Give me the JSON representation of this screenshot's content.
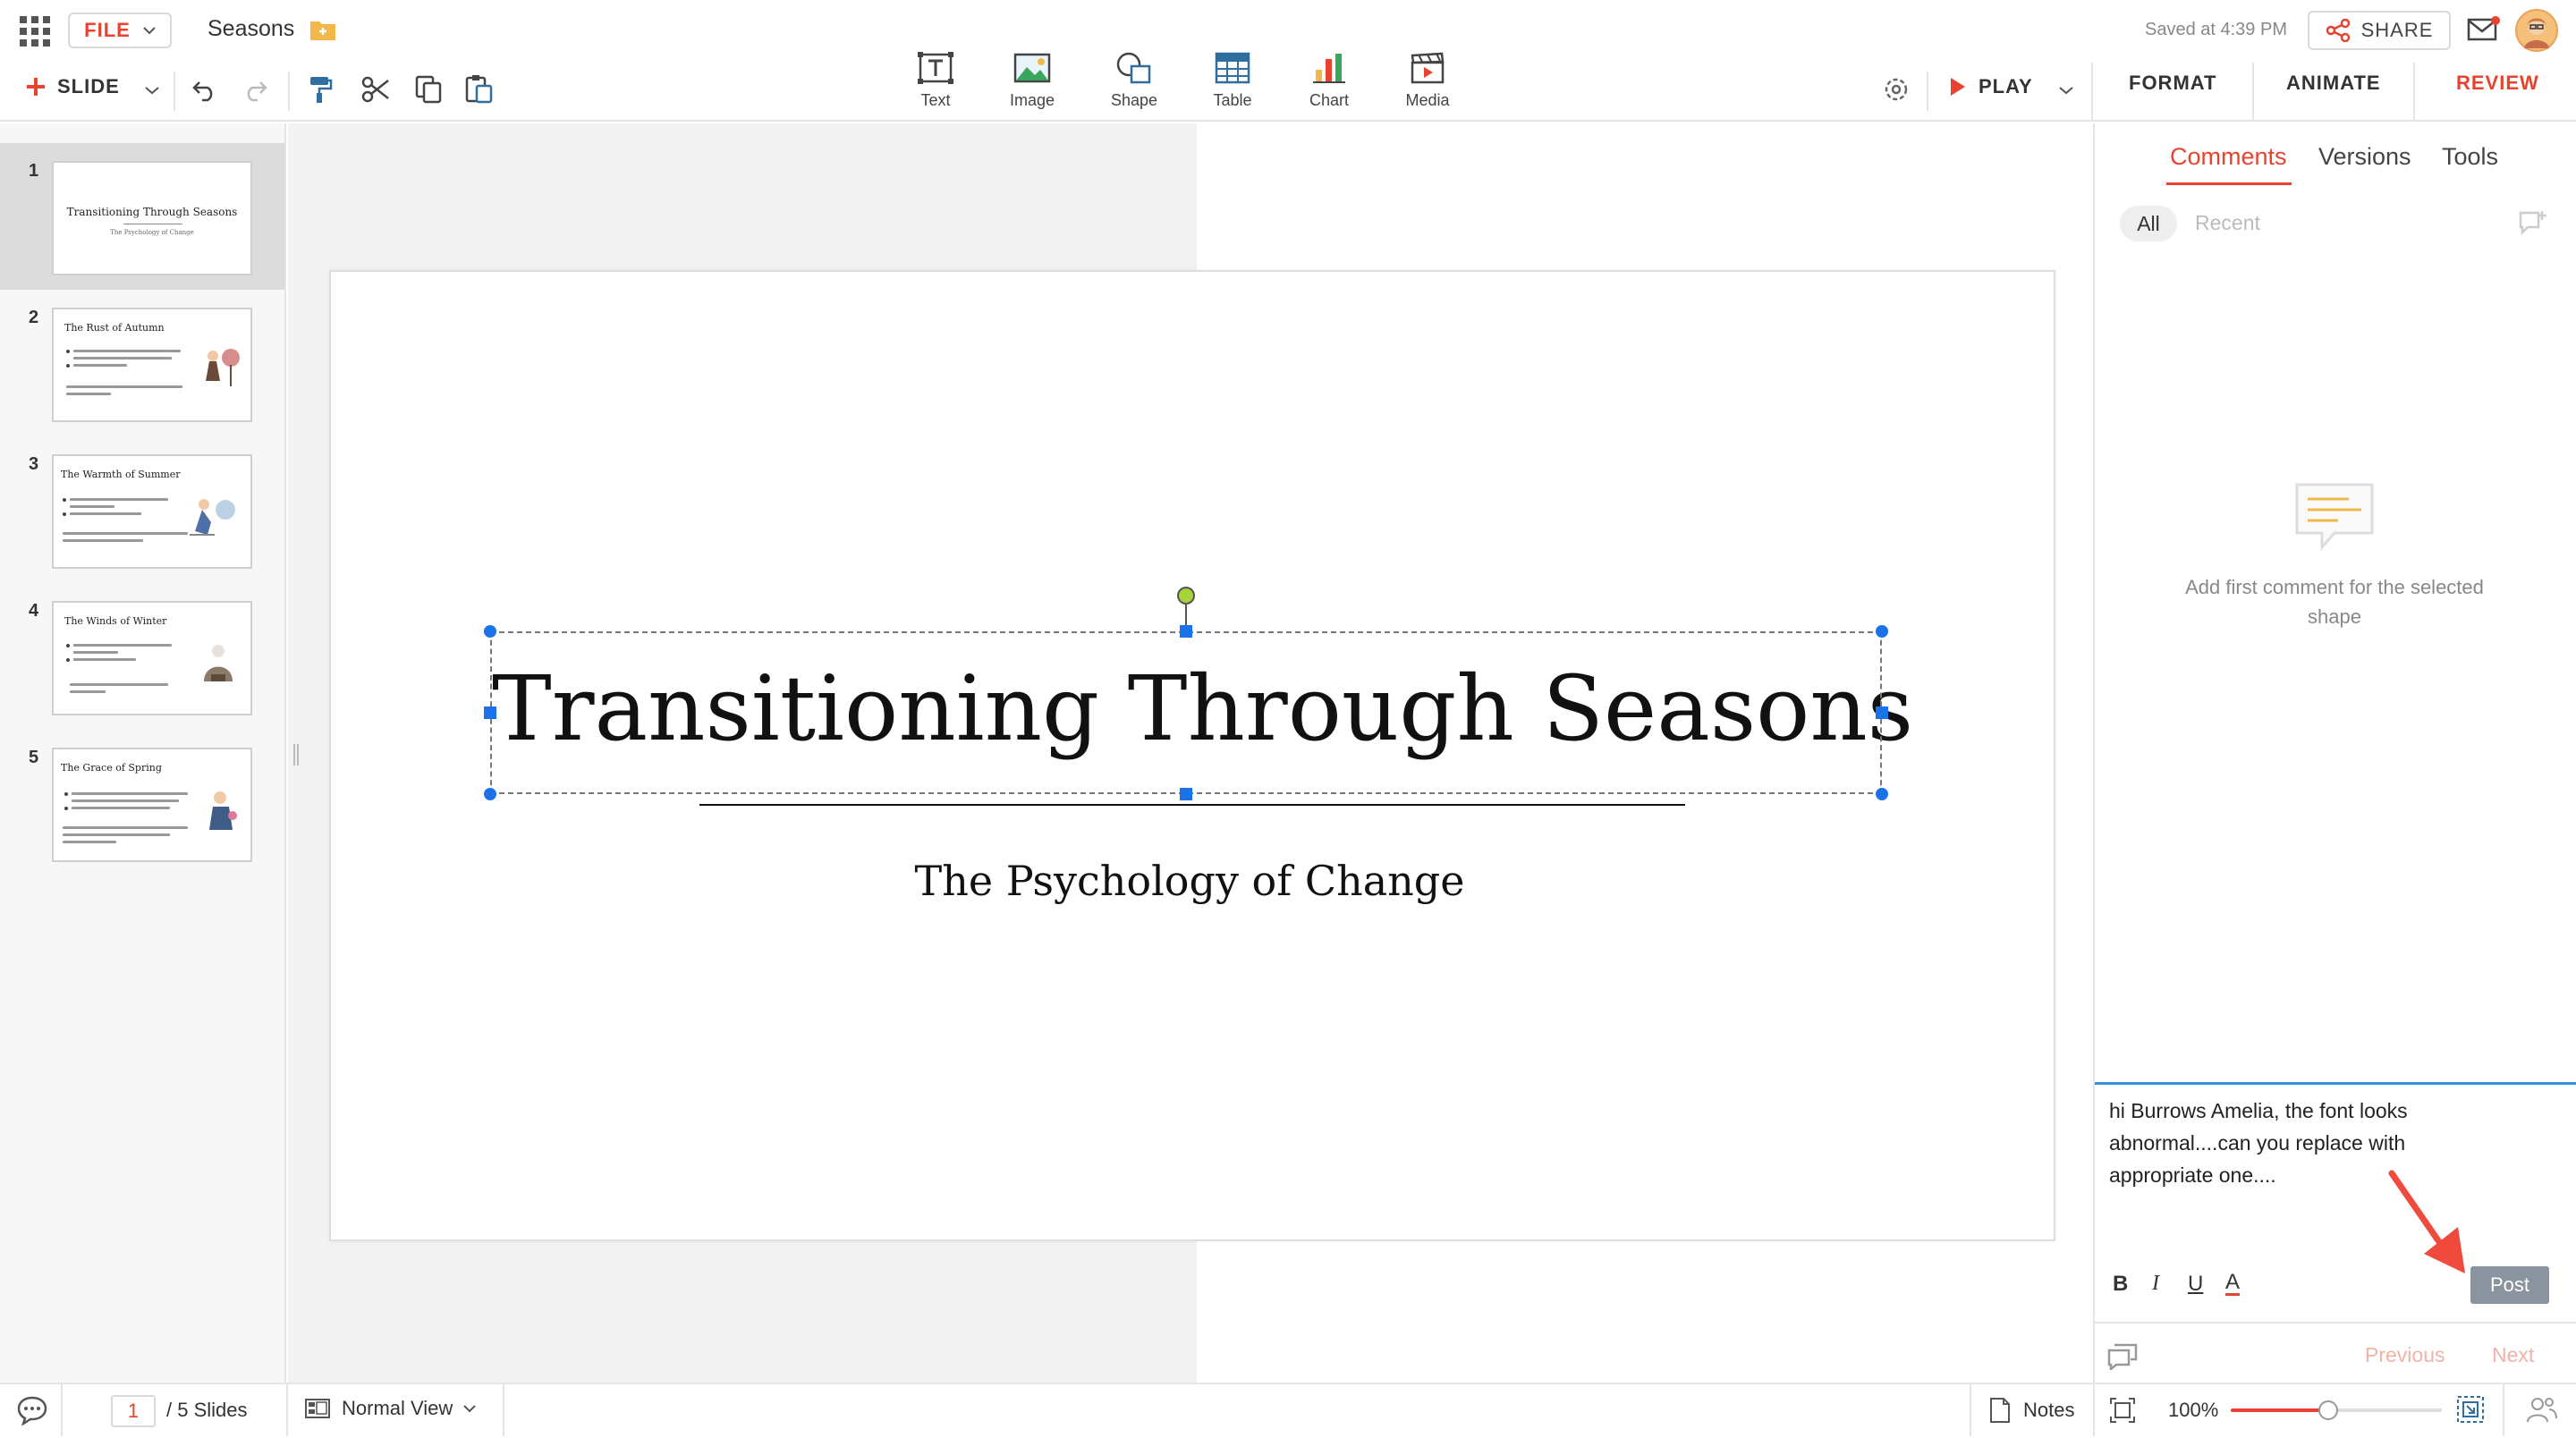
{
  "header": {
    "file_label": "FILE",
    "doc_title": "Seasons",
    "saved_status": "Saved at 4:39 PM",
    "share_label": "SHARE"
  },
  "toolbar": {
    "slide_label": "SLIDE",
    "insert_tools": [
      {
        "label": "Text",
        "icon": "text-box-icon"
      },
      {
        "label": "Image",
        "icon": "image-icon"
      },
      {
        "label": "Shape",
        "icon": "shape-icon"
      },
      {
        "label": "Table",
        "icon": "table-icon"
      },
      {
        "label": "Chart",
        "icon": "chart-icon"
      },
      {
        "label": "Media",
        "icon": "media-icon"
      }
    ],
    "play_label": "PLAY",
    "right_tabs": [
      {
        "label": "FORMAT"
      },
      {
        "label": "ANIMATE"
      },
      {
        "label": "REVIEW"
      }
    ],
    "accent_color": "#e8432e"
  },
  "slides": [
    {
      "number": "1",
      "title": "Transitioning Through Seasons",
      "subtitle": "The Psychology of Change"
    },
    {
      "number": "2",
      "title": "The Rust of Autumn"
    },
    {
      "number": "3",
      "title": "The Warmth of Summer"
    },
    {
      "number": "4",
      "title": "The Winds of Winter"
    },
    {
      "number": "5",
      "title": "The Grace of Spring"
    }
  ],
  "current_slide": {
    "title": "Transitioning Through Seasons",
    "subtitle": "The Psychology of Change"
  },
  "panel": {
    "tabs": [
      {
        "label": "Comments"
      },
      {
        "label": "Versions"
      },
      {
        "label": "Tools"
      }
    ],
    "filter_all": "All",
    "filter_recent": "Recent",
    "empty_message": "Add first comment for the selected shape",
    "comment_draft": "hi Burrows Amelia, the font looks abnormal....can you replace with appropriate one....",
    "post_label": "Post",
    "previous_label": "Previous",
    "next_label": "Next"
  },
  "statusbar": {
    "current_page": "1",
    "slides_count": "/ 5 Slides",
    "view_mode": "Normal View",
    "notes_label": "Notes",
    "zoom_label": "100%",
    "zoom_level_percent": 100
  }
}
